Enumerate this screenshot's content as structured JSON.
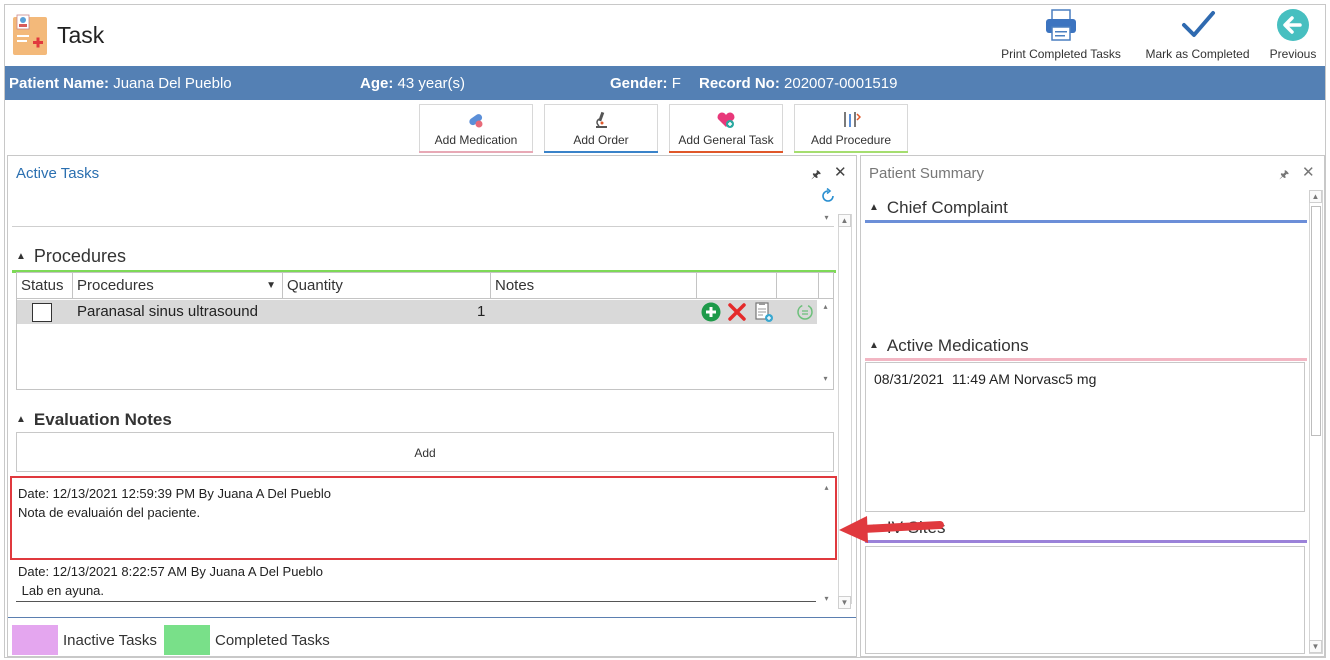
{
  "app": {
    "title": "Task"
  },
  "toolbar": {
    "print_label": "Print Completed Tasks",
    "mark_label": "Mark as Completed",
    "previous_label": "Previous"
  },
  "patient": {
    "name_label": "Patient Name:",
    "name": "Juana Del Pueblo",
    "age_label": "Age:",
    "age": "43 year(s)",
    "gender_label": "Gender:",
    "gender": "F",
    "record_label": "Record No:",
    "record": "202007-0001519"
  },
  "actions": [
    {
      "label": "Add Medication",
      "color": "#e8a9b6"
    },
    {
      "label": "Add Order",
      "color": "#3a83c9"
    },
    {
      "label": "Add General Task",
      "color": "#e0582a"
    },
    {
      "label": "Add Procedure",
      "color": "#a5de6f"
    }
  ],
  "active_tasks": {
    "title": "Active Tasks",
    "procedures": {
      "header": "Procedures",
      "accent": "#7ed957",
      "columns": [
        "Status",
        "Procedures",
        "Quantity",
        "Notes"
      ],
      "rows": [
        {
          "procedure": "Paranasal sinus ultrasound",
          "quantity": "1"
        }
      ]
    },
    "evaluation_notes": {
      "header": "Evaluation Notes",
      "add_label": "Add",
      "notes": [
        {
          "meta": "Date: 12/13/2021 12:59:39 PM By Juana A Del Pueblo",
          "text": "Nota de evaluaión del paciente."
        },
        {
          "meta": "Date: 12/13/2021 8:22:57 AM By Juana A Del Pueblo",
          "text": " Lab en ayuna."
        }
      ]
    },
    "legend": [
      {
        "label": "Inactive Tasks",
        "color": "#e4a6ef"
      },
      {
        "label": "Completed Tasks",
        "color": "#79e089"
      }
    ]
  },
  "patient_summary": {
    "title": "Patient Summary",
    "sections": [
      {
        "header": "Chief Complaint",
        "accent": "#6c8fd8"
      },
      {
        "header": "Active Medications",
        "accent": "#f2b6c3"
      },
      {
        "header": "IV Sites",
        "accent": "#9b82d9"
      }
    ],
    "medications": [
      {
        "date": "08/31/2021",
        "time": "11:49 AM",
        "name": "Norvasc",
        "dose": "5 mg"
      }
    ]
  },
  "colors": {
    "patient_bar": "#5480b4",
    "highlight": "#e0393e",
    "panel_title": "#2a6fb0"
  }
}
